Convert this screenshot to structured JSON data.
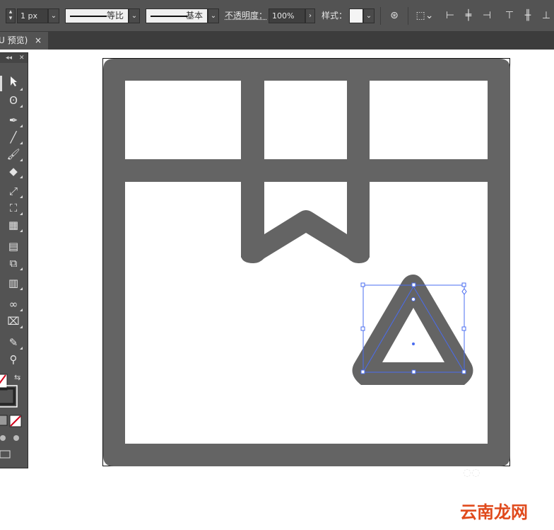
{
  "control_bar": {
    "stroke_weight": "1 px",
    "stroke_profile": "等比",
    "brush": "基本",
    "opacity_label": "不透明度：",
    "opacity_value": "100%",
    "style_label": "样式："
  },
  "doc_tab": {
    "title": "U 预览)",
    "close": "×"
  },
  "toolbox": {
    "collapse": "◂◂",
    "close": "✕"
  },
  "watermark": "云南龙网",
  "colors": {
    "artwork_fill": "#646464",
    "selection": "#3d6bf5",
    "chrome": "#535353"
  }
}
